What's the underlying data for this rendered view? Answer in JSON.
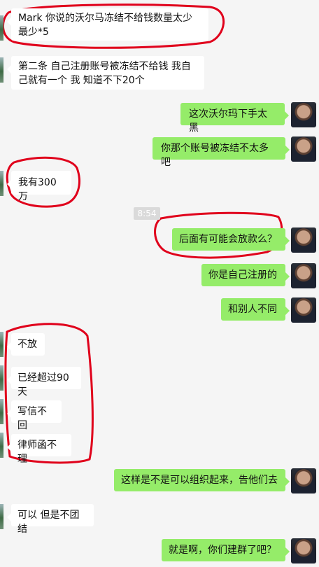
{
  "messages": [
    {
      "side": "in",
      "text": "Mark 你说的沃尔马冻结不给钱数量太少 最少*5"
    },
    {
      "side": "in",
      "text": "第二条 自己注册账号被冻结不给钱 我自己就有一个 我 知道不下20个"
    },
    {
      "side": "out",
      "text": "这次沃尔玛下手太黑"
    },
    {
      "side": "out",
      "text": "你那个账号被冻结不太多吧"
    },
    {
      "side": "in",
      "text": "我有300万"
    },
    {
      "side": "out",
      "text": "后面有可能会放款么？"
    },
    {
      "side": "out",
      "text": "你是自己注册的"
    },
    {
      "side": "out",
      "text": "和别人不同"
    },
    {
      "side": "in",
      "text": "不放"
    },
    {
      "side": "in",
      "text": "已经超过90天"
    },
    {
      "side": "in",
      "text": "写信不回"
    },
    {
      "side": "in",
      "text": "律师函不理"
    },
    {
      "side": "out",
      "text": "这样是不是可以组织起来，告他们去"
    },
    {
      "side": "in",
      "text": "可以 但是不团结"
    },
    {
      "side": "out",
      "text": "就是啊，你们建群了吧？"
    }
  ],
  "timestamp": "8:54",
  "colors": {
    "background": "#f5f5f5",
    "incoming_bubble": "#ffffff",
    "outgoing_bubble": "#95ec69",
    "annotation": "#e0001b"
  }
}
